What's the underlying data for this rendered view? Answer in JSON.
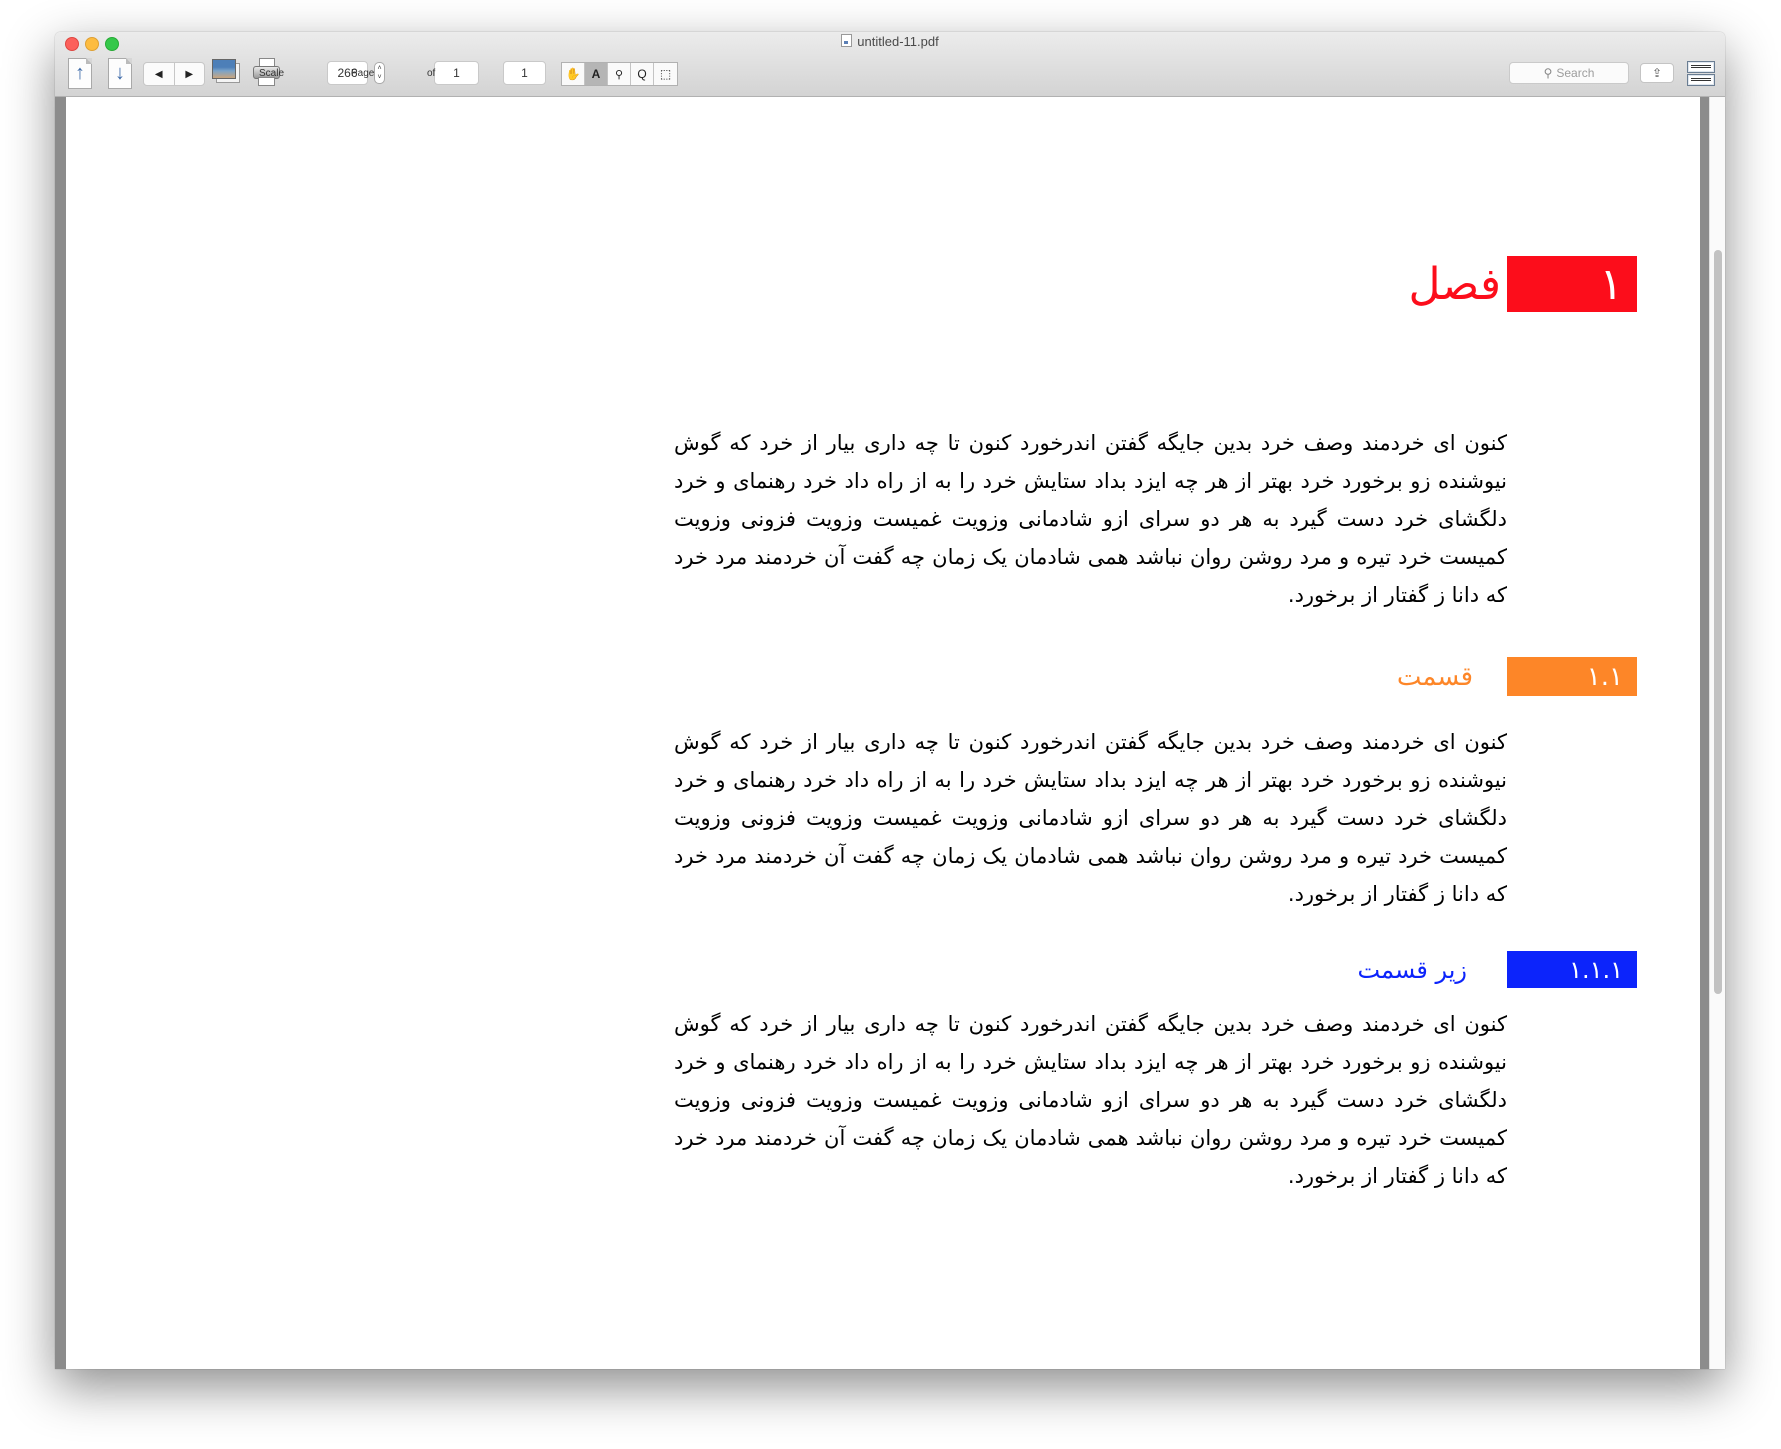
{
  "window": {
    "title": "untitled-11.pdf"
  },
  "toolbar": {
    "prev_page_icon": "doc-arrow-up-icon",
    "next_page_icon": "doc-arrow-down-icon",
    "back_label": "◀",
    "forward_label": "▶",
    "scale_label": "Scale",
    "scale_value": "266",
    "page_label": "Page",
    "page_value": "1",
    "of_label": "of",
    "page_total": "1",
    "tools": [
      {
        "name": "hand",
        "glyph": "✋",
        "selected": false
      },
      {
        "name": "text-select",
        "glyph": "A",
        "selected": true
      },
      {
        "name": "zoom-in",
        "glyph": "🔍",
        "selected": false
      },
      {
        "name": "zoom-out",
        "glyph": "Q",
        "selected": false
      },
      {
        "name": "marquee-select",
        "glyph": "⬚",
        "selected": false
      }
    ],
    "search_placeholder": "Search",
    "share_glyph": "⇪"
  },
  "document": {
    "chapter": {
      "number": "١",
      "title": "فصل",
      "color": "#fc0d1b"
    },
    "section": {
      "number": "١.١",
      "title": "قسمت",
      "color": "#fd8628"
    },
    "subsection": {
      "number": "١.١.١",
      "title": "زیر قسمت",
      "color": "#0c24fb"
    },
    "paragraph": "کنون ای خردمند وصف خرد بدین جایگه گفتن اندرخورد کنون تا چه داری بیار از خرد که گوش نیوشنده زو برخورد خرد بهتر از هر چه ایزد بداد ستایش خرد را به از راه داد خرد رهنمای و خرد دلگشای خرد دست گیرد به هر دو سرای ازو شادمانی وزویت غمیست وزویت فزونی وزویت کمیست خرد تیره و مرد روشن روان نباشد همی شادمان یک زمان چه گفت آن خردمند مرد خرد که دانا ز گفتار از برخورد."
  }
}
